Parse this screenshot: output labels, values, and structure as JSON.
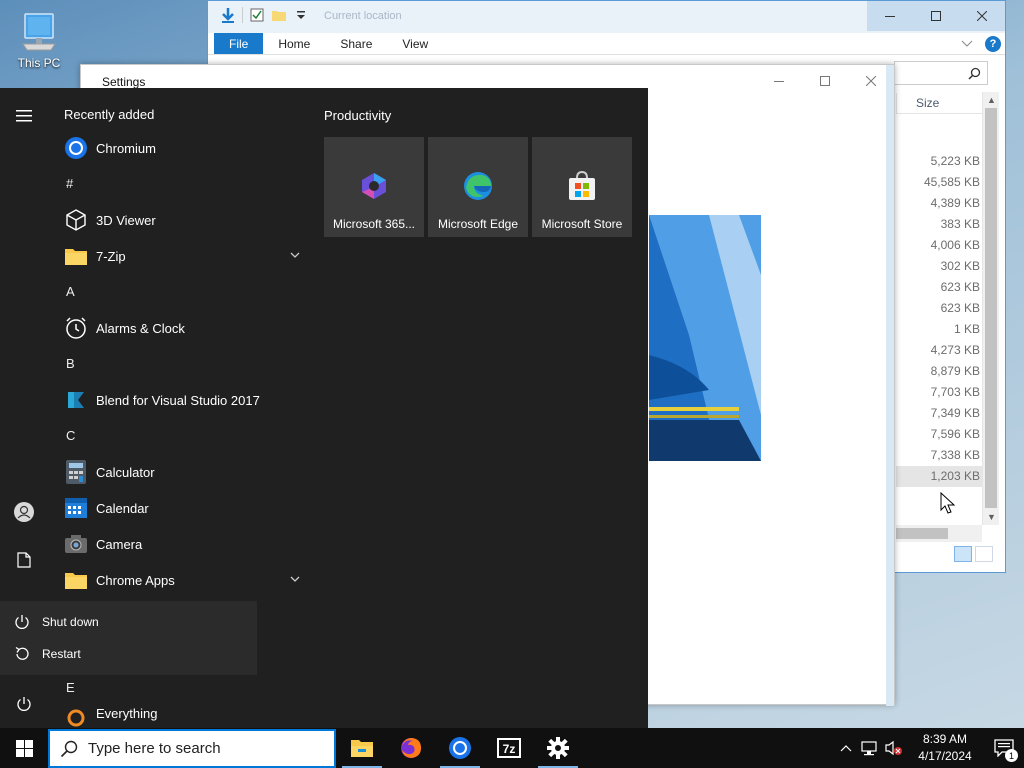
{
  "desktop": {
    "icon_label": "This PC"
  },
  "explorer": {
    "title": "Current location",
    "tabs": [
      "File",
      "Home",
      "Share",
      "View"
    ],
    "column_size": "Size",
    "sizes": [
      "5,223 KB",
      "45,585 KB",
      "4,389 KB",
      "383 KB",
      "4,006 KB",
      "302 KB",
      "623 KB",
      "623 KB",
      "1 KB",
      "4,273 KB",
      "8,879 KB",
      "7,703 KB",
      "7,349 KB",
      "7,596 KB",
      "7,338 KB",
      "1,203 KB"
    ]
  },
  "settings": {
    "title": "Settings"
  },
  "start": {
    "recently_added": "Recently added",
    "productivity": "Productivity",
    "apps": {
      "chromium": "Chromium",
      "hash": "#",
      "viewer3d": "3D Viewer",
      "zip7": "7-Zip",
      "letter_a": "A",
      "alarms": "Alarms & Clock",
      "letter_b": "B",
      "blend": "Blend for Visual Studio 2017",
      "letter_c": "C",
      "calculator": "Calculator",
      "calendar": "Calendar",
      "camera": "Camera",
      "chrome_apps": "Chrome Apps",
      "letter_e": "E",
      "everything": "Everything"
    },
    "tiles": [
      "Microsoft 365...",
      "Microsoft Edge",
      "Microsoft Store"
    ],
    "power_menu": {
      "shutdown": "Shut down",
      "restart": "Restart"
    }
  },
  "taskbar": {
    "search_placeholder": "Type here to search",
    "time": "8:39 AM",
    "date": "4/17/2024",
    "notification_count": "1"
  }
}
